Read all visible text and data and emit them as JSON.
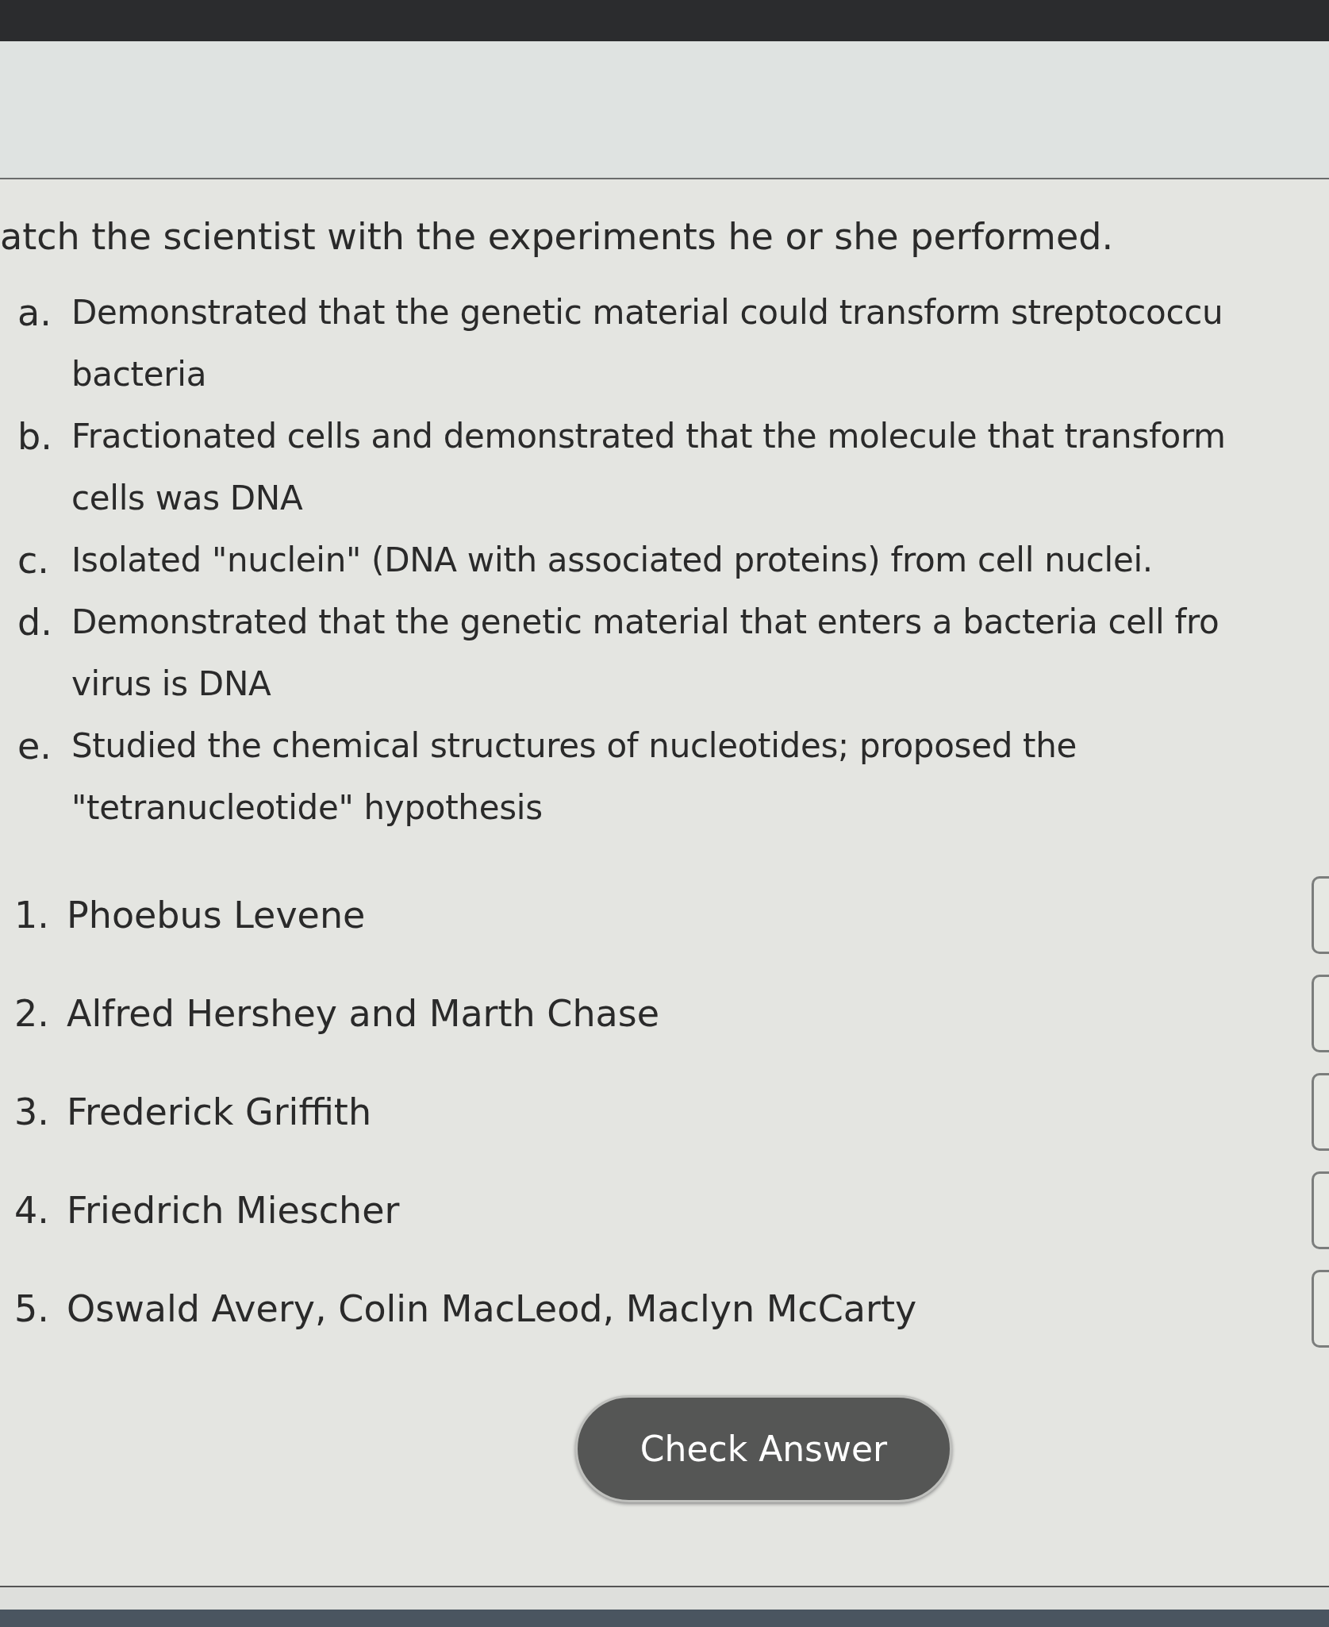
{
  "question": "atch the scientist with the experiments he or she performed.",
  "descriptions": [
    {
      "letter": "a.",
      "lines": [
        "Demonstrated that the genetic material could transform streptococcu",
        "bacteria"
      ]
    },
    {
      "letter": "b.",
      "lines": [
        "Fractionated cells and demonstrated that the molecule that transform",
        "cells was DNA"
      ]
    },
    {
      "letter": "c.",
      "lines": [
        "Isolated \"nuclein\" (DNA with associated proteins) from cell nuclei."
      ]
    },
    {
      "letter": "d.",
      "lines": [
        "Demonstrated that the genetic material that enters a bacteria cell fro",
        "virus is DNA"
      ]
    },
    {
      "letter": "e.",
      "lines": [
        "Studied the chemical structures of nucleotides; proposed the",
        "\"tetranucleotide\" hypothesis"
      ]
    }
  ],
  "scientists": [
    {
      "number": "1.",
      "name": "Phoebus Levene"
    },
    {
      "number": "2.",
      "name": "Alfred Hershey and Marth Chase"
    },
    {
      "number": "3.",
      "name": "Frederick Griffith"
    },
    {
      "number": "4.",
      "name": "Friedrich Miescher"
    },
    {
      "number": "5.",
      "name": "Oswald Avery, Colin MacLeod, Maclyn McCarty"
    }
  ],
  "button": "Check Answer"
}
